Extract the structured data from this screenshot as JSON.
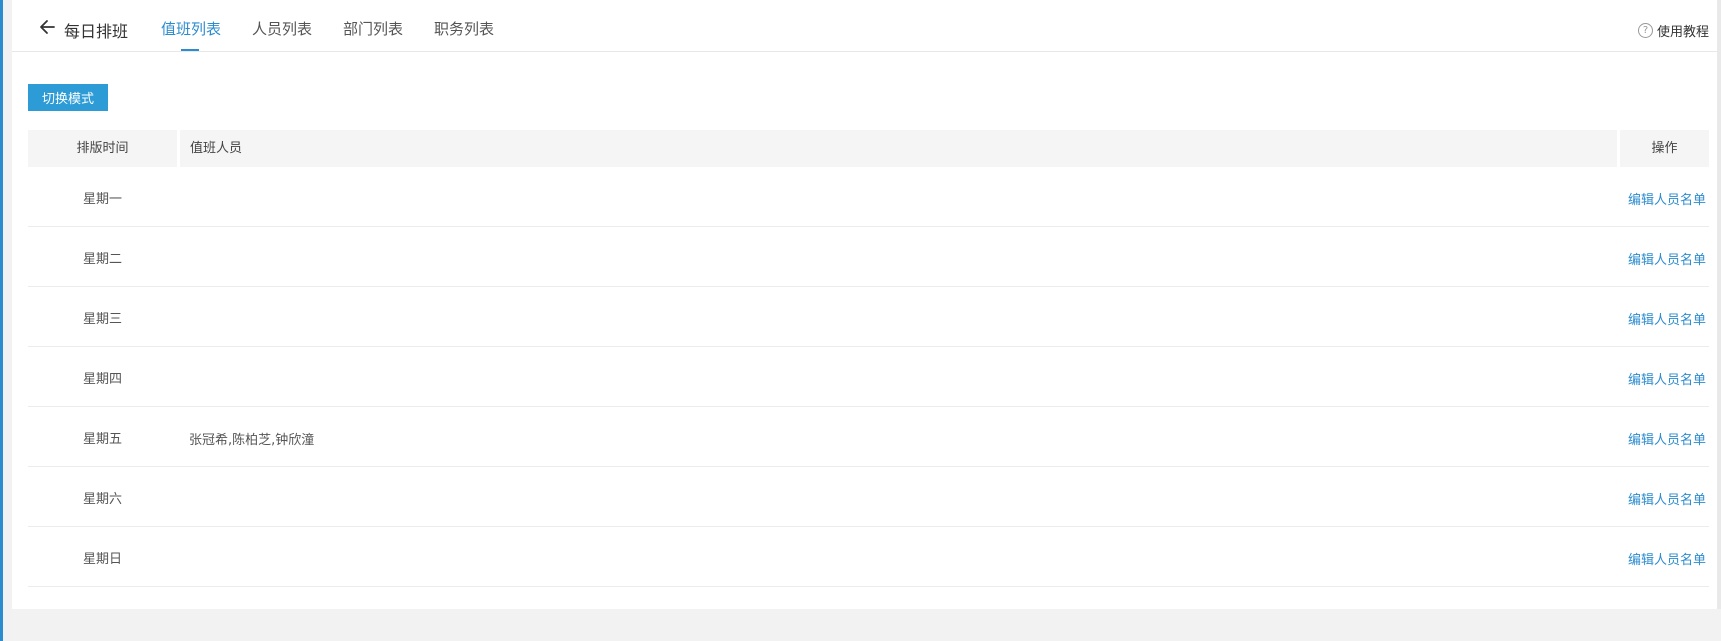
{
  "header": {
    "title": "每日排班",
    "tabs": [
      {
        "label": "值班列表",
        "active": true
      },
      {
        "label": "人员列表",
        "active": false
      },
      {
        "label": "部门列表",
        "active": false
      },
      {
        "label": "职务列表",
        "active": false
      }
    ],
    "help_label": "使用教程"
  },
  "toolbar": {
    "switch_mode_label": "切换模式"
  },
  "table": {
    "columns": {
      "time": "排版时间",
      "people": "值班人员",
      "ops": "操作"
    },
    "rows": [
      {
        "day": "星期一",
        "people": "",
        "action": "编辑人员名单"
      },
      {
        "day": "星期二",
        "people": "",
        "action": "编辑人员名单"
      },
      {
        "day": "星期三",
        "people": "",
        "action": "编辑人员名单"
      },
      {
        "day": "星期四",
        "people": "",
        "action": "编辑人员名单"
      },
      {
        "day": "星期五",
        "people": "张冠希,陈柏芝,钟欣潼",
        "action": "编辑人员名单"
      },
      {
        "day": "星期六",
        "people": "",
        "action": "编辑人员名单"
      },
      {
        "day": "星期日",
        "people": "",
        "action": "编辑人员名单"
      }
    ]
  },
  "colors": {
    "accent": "#2d8ccf",
    "button": "#2d9bd6",
    "header_bg": "#f5f5f5"
  },
  "icons": {
    "back": "arrow-left-icon",
    "help": "question-circle-icon"
  }
}
